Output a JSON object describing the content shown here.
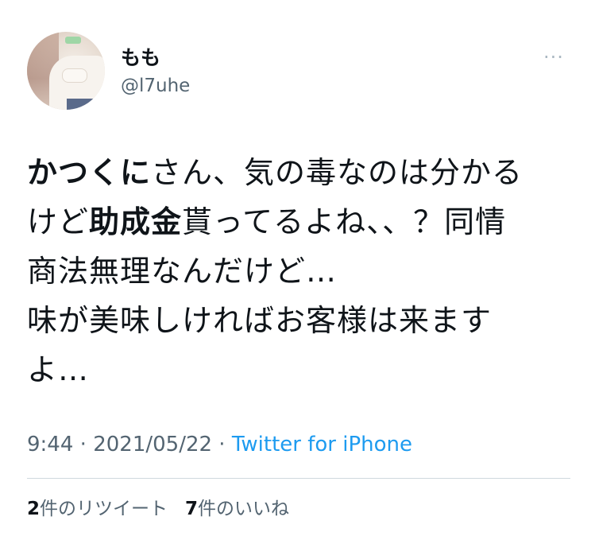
{
  "user": {
    "display_name": "もも",
    "handle": "@l7uhe",
    "avatar_icon": "profile-photo"
  },
  "menu": {
    "icon": "more-icon",
    "glyph": "···"
  },
  "tweet": {
    "line1_bold": "かつくに",
    "line1_rest": "さん、気の毒なのは分かる",
    "line2_pre": "けど",
    "line2_bold": "助成金",
    "line2_post": "貰ってるよね、、？同情",
    "line3": "商法無理なんだけど…",
    "line4": "味が美味しければお客様は来ます",
    "line5": "よ…"
  },
  "meta": {
    "time": "9:44",
    "sep1": " · ",
    "date": "2021/05/22",
    "sep2": " · ",
    "source": "Twitter for iPhone"
  },
  "stats": {
    "retweet_count": "2",
    "retweet_label": "件のリツイート",
    "like_count": "7",
    "like_label": "件のいいね"
  },
  "colors": {
    "link": "#1d9bf0",
    "secondary_text": "#536471",
    "primary_text": "#0f1419",
    "divider": "#cfd9de"
  }
}
